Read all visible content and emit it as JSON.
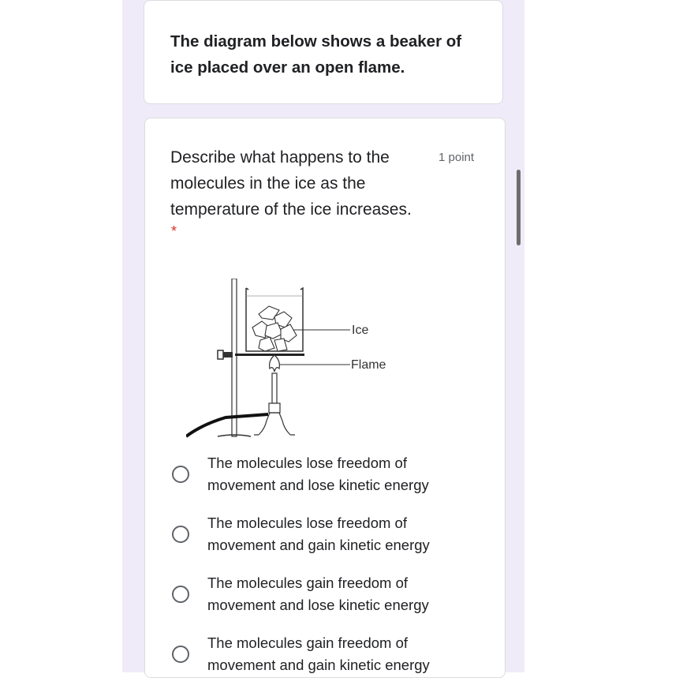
{
  "description_card": {
    "text": "The diagram below shows a beaker of ice placed over an open flame."
  },
  "question": {
    "text": "Describe what happens to the molecules in the ice as the temperature of the ice increases.",
    "points": "1 point",
    "required_mark": "*",
    "figure": {
      "label_ice": "Ice",
      "label_flame": "Flame"
    },
    "options": [
      {
        "label": "The molecules lose freedom of movement and lose kinetic energy"
      },
      {
        "label": "The molecules lose freedom of movement and gain kinetic energy"
      },
      {
        "label": "The molecules gain freedom of movement and lose kinetic energy"
      },
      {
        "label": "The molecules gain freedom of movement and gain kinetic energy"
      }
    ]
  }
}
